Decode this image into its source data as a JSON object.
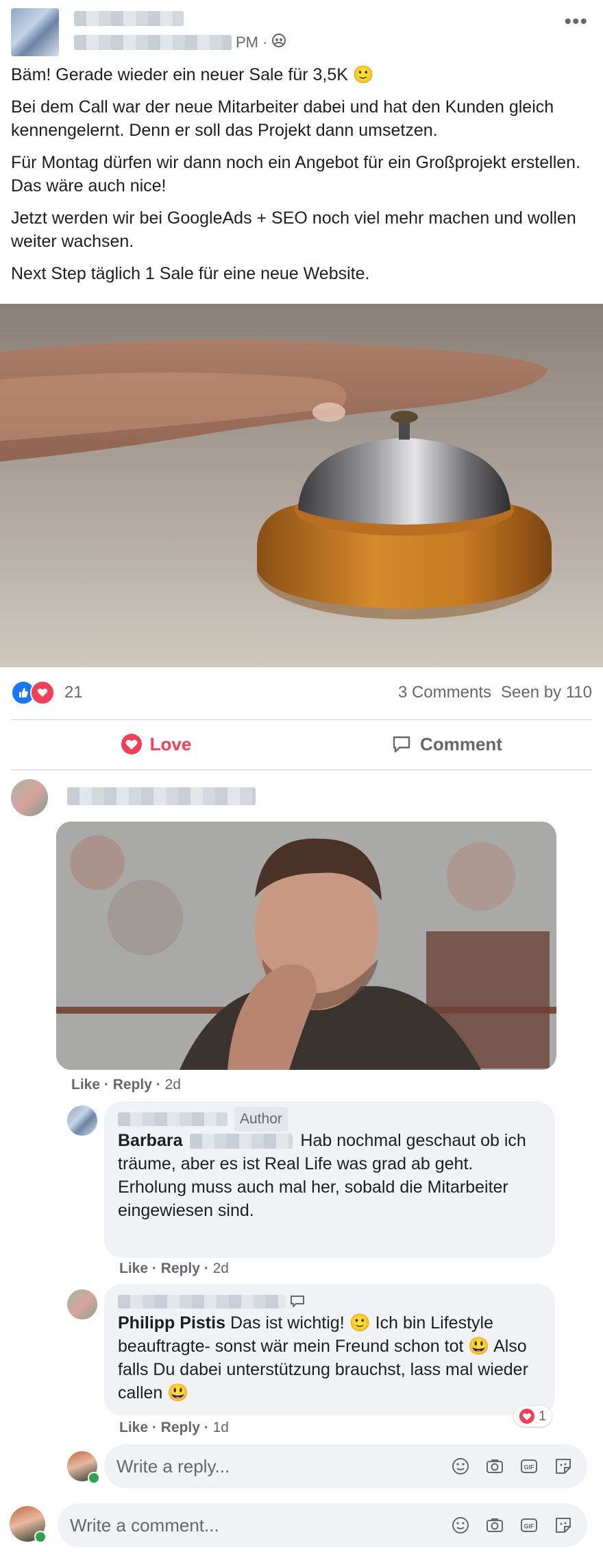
{
  "header": {
    "time_suffix": "PM ·",
    "privacy_icon": "group-icon",
    "more_icon": "more-dots-icon"
  },
  "post": {
    "paragraphs": [
      "Bäm! Gerade wieder ein neuer Sale für 3,5K 🙂",
      "Bei dem Call war der neue Mitarbeiter dabei und hat den Kunden gleich kennengelernt. Denn er soll das Projekt dann umsetzen.",
      "Für Montag dürfen wir dann noch ein Angebot für ein Großprojekt erstellen. Das wäre auch nice!",
      "Jetzt werden wir bei GoogleAds + SEO noch viel mehr machen und wollen weiter wachsen.",
      "Next Step täglich 1 Sale für eine neue Website."
    ]
  },
  "reactions": {
    "count": "21",
    "comments": "3 Comments",
    "seen": "Seen by 110"
  },
  "actions": {
    "love": "Love",
    "comment": "Comment"
  },
  "comments": [
    {
      "links": {
        "like": "Like",
        "reply": "Reply",
        "time": "2d"
      }
    }
  ],
  "replies": [
    {
      "badge": "Author",
      "name": "Barbara",
      "text": "Hab nochmal geschaut ob ich träume, aber es ist Real Life was grad ab geht.",
      "text2": "Erholung muss auch mal her, sobald die Mitarbeiter eingewiesen sind.",
      "links": {
        "like": "Like",
        "reply": "Reply",
        "time": "2d"
      }
    },
    {
      "name": "Philipp Pistis",
      "text": "Das ist wichtig! 🙂 Ich bin Lifestyle beauftragte- sonst wär mein Freund schon tot 😃 Also falls Du dabei unterstützung brauchst, lass mal wieder callen 😃",
      "reaction_count": "1",
      "links": {
        "like": "Like",
        "reply": "Reply",
        "time": "1d"
      }
    }
  ],
  "reply_input": {
    "placeholder": "Write a reply..."
  },
  "comment_input": {
    "placeholder": "Write a comment..."
  },
  "colors": {
    "love": "#f33e58",
    "like": "#1877f2",
    "muted": "#65676b",
    "bubble": "#f0f2f5"
  }
}
